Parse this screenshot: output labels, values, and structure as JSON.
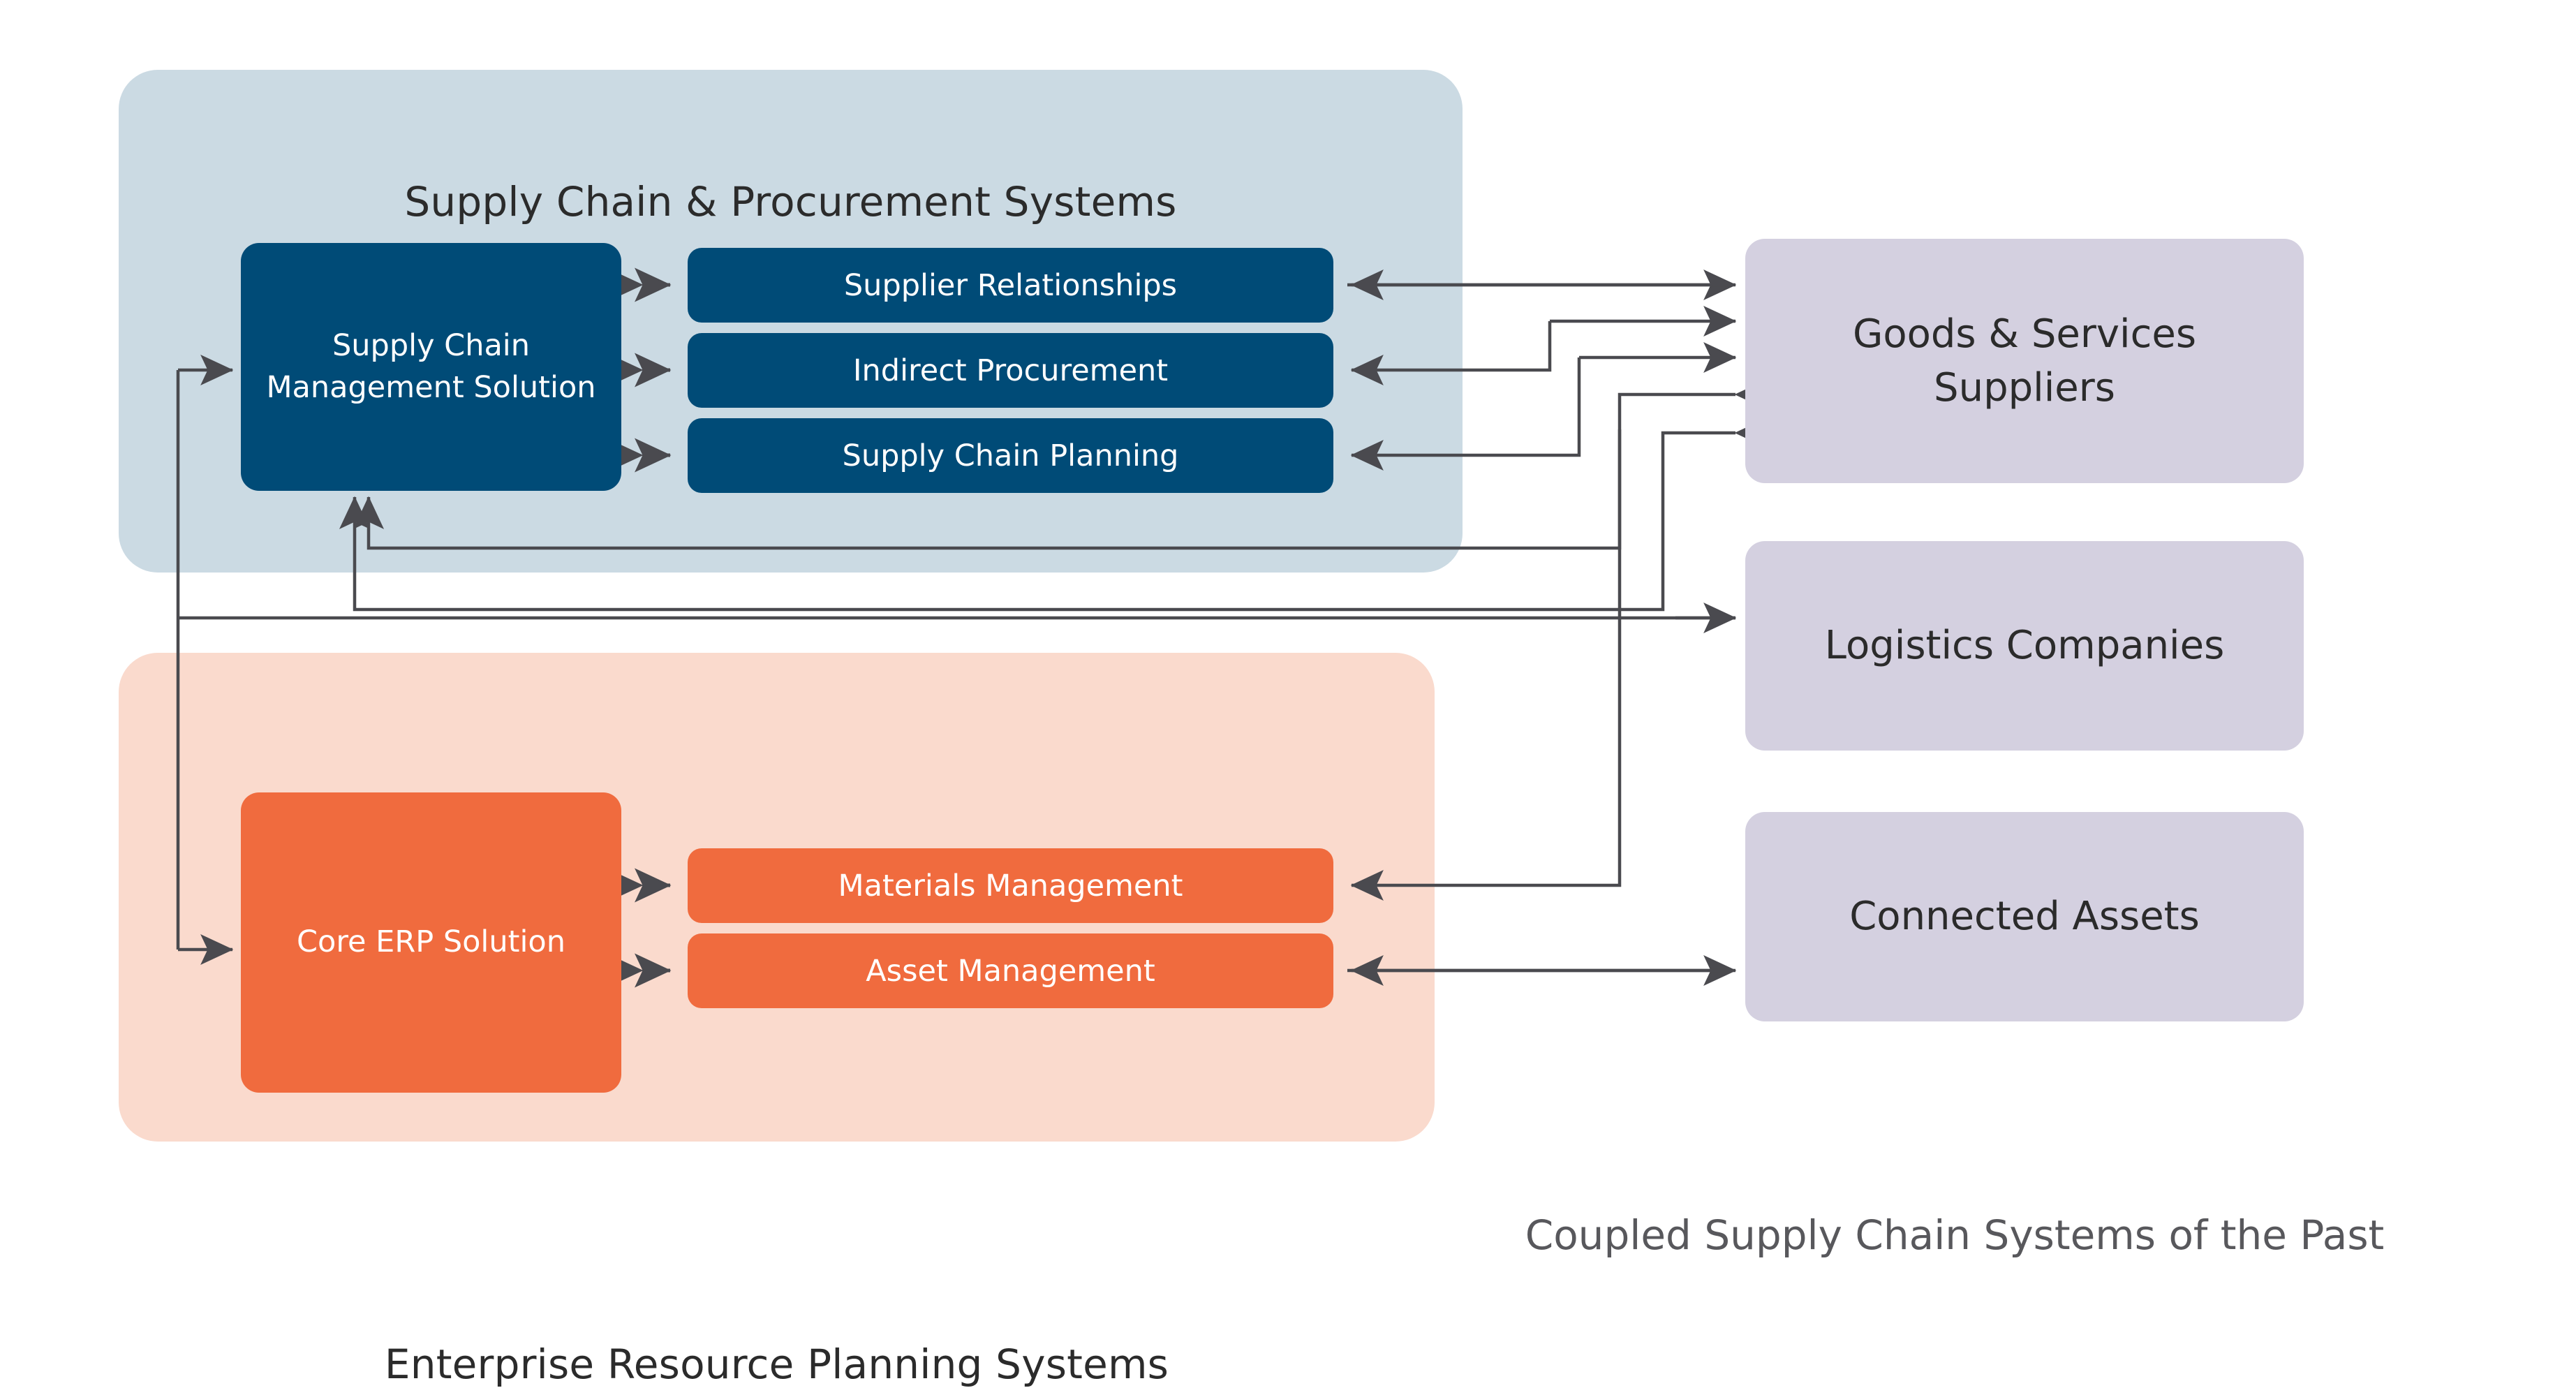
{
  "caption": "Coupled Supply Chain Systems of the Past",
  "panels": [
    {
      "id": "scm",
      "title": "Supply Chain & Procurement Systems",
      "bg_color": "#cbdae3"
    },
    {
      "id": "erp",
      "title": "Enterprise Resource Planning Systems",
      "bg_color": "#fadacd"
    }
  ],
  "solutions": [
    {
      "id": "scm-solution",
      "label": "Supply Chain Management Solution",
      "color": "#004b77"
    },
    {
      "id": "erp-solution",
      "label": "Core ERP Solution",
      "color": "#f06b3e"
    }
  ],
  "capabilities": {
    "supply_chain": [
      {
        "id": "supplier-relationships",
        "label": "Supplier Relationships",
        "color": "#004b77"
      },
      {
        "id": "indirect-procurement",
        "label": "Indirect Procurement",
        "color": "#004b77"
      },
      {
        "id": "supply-chain-planning",
        "label": "Supply Chain Planning",
        "color": "#004b77"
      }
    ],
    "erp": [
      {
        "id": "materials-management",
        "label": "Materials Management",
        "color": "#f06b3e"
      },
      {
        "id": "asset-management",
        "label": "Asset Management",
        "color": "#f06b3e"
      }
    ]
  },
  "entities": [
    {
      "id": "goods-services-suppliers",
      "label": "Goods & Services Suppliers",
      "color": "#d4d0e0"
    },
    {
      "id": "logistics-companies",
      "label": "Logistics Companies",
      "color": "#d4d0e0"
    },
    {
      "id": "connected-assets",
      "label": "Connected Assets",
      "color": "#d4d0e0"
    }
  ],
  "colors": {
    "dark_blue": "#004b77",
    "light_blue_panel": "#cbdae3",
    "orange": "#f06b3e",
    "light_orange_panel": "#fadacd",
    "lavender": "#d4d0e0",
    "connector": "#4a4a4f",
    "text_dark": "#2b2b2b",
    "caption_gray": "#58585c"
  }
}
